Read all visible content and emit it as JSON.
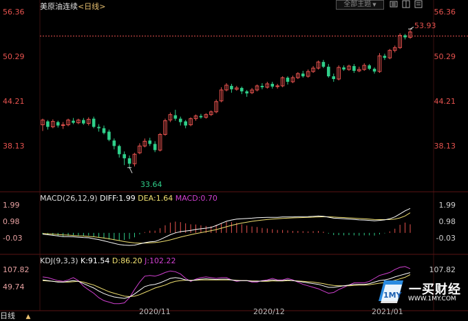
{
  "header": {
    "instrument": "美原油连续",
    "period": "<日线>",
    "theme_button": "全部主题",
    "theme_caret": "▼"
  },
  "price_axis": {
    "left_labels": [
      "56.36",
      "50.29",
      "44.21",
      "38.13"
    ],
    "right_labels": [
      "56.36",
      "50.29",
      "44.21",
      "38.13"
    ],
    "ymin": 30.5,
    "ymax": 56.36
  },
  "annotations": {
    "high_label": "53.93",
    "low_label": "33.64",
    "reference_price": 52.9
  },
  "macd": {
    "label": "MACD(26,12,9)",
    "diff_label": "DIFF:1.99",
    "dea_label": "DEA:1.64",
    "macd_label": "MACD:0.70",
    "axis_labels": [
      "1.99",
      "0.98",
      "-0.03"
    ],
    "ymin": -1.3,
    "ymax": 2.4
  },
  "kdj": {
    "label": "KDJ(9,3,3)",
    "k_label": "K:91.54",
    "d_label": "D:86.20",
    "j_label": "J:102.22",
    "axis_labels": [
      "107.82",
      "49.74"
    ],
    "ymin": 0,
    "ymax": 115
  },
  "x_axis": {
    "labels": [
      "2020/11",
      "2020/12",
      "2021/01"
    ]
  },
  "bottom": {
    "period_label": "日线",
    "caret": "▲"
  },
  "watermark": {
    "name": "一买财经",
    "url": "WWW.1MY.COM",
    "badge_text": "1MY"
  },
  "colors": {
    "up": "#e8534f",
    "down": "#2fcf8a",
    "diff_line": "#ffffff",
    "dea_line": "#f0e070",
    "j_line": "#d040d0",
    "ref_line": "#e8534f"
  },
  "chart_data": {
    "type": "candlestick",
    "title": "美原油连续",
    "candles": [
      [
        39.9,
        40.6,
        39.0,
        40.8,
        "up"
      ],
      [
        40.4,
        39.6,
        39.2,
        40.6,
        "down"
      ],
      [
        39.6,
        40.4,
        39.4,
        40.7,
        "up"
      ],
      [
        40.3,
        39.8,
        39.5,
        40.5,
        "down"
      ],
      [
        39.8,
        39.9,
        39.3,
        40.3,
        "up"
      ],
      [
        39.9,
        40.6,
        39.7,
        40.8,
        "up"
      ],
      [
        40.5,
        40.2,
        40.0,
        40.9,
        "down"
      ],
      [
        40.2,
        40.6,
        40.0,
        40.8,
        "up"
      ],
      [
        40.6,
        40.1,
        39.9,
        40.9,
        "down"
      ],
      [
        40.1,
        40.7,
        39.8,
        41.0,
        "up"
      ],
      [
        40.8,
        39.6,
        39.4,
        41.1,
        "down"
      ],
      [
        39.6,
        39.4,
        38.9,
        40.0,
        "down"
      ],
      [
        39.4,
        38.7,
        38.5,
        39.8,
        "down"
      ],
      [
        38.9,
        37.7,
        37.5,
        39.2,
        "down"
      ],
      [
        37.6,
        36.8,
        36.3,
        37.9,
        "down"
      ],
      [
        36.8,
        35.6,
        35.1,
        37.0,
        "down"
      ],
      [
        35.6,
        35.0,
        34.0,
        36.0,
        "down"
      ],
      [
        35.0,
        34.2,
        33.64,
        35.4,
        "down"
      ],
      [
        34.2,
        35.6,
        33.8,
        35.8,
        "up"
      ],
      [
        35.8,
        36.8,
        35.6,
        37.2,
        "up"
      ],
      [
        36.8,
        37.5,
        36.6,
        37.9,
        "up"
      ],
      [
        37.6,
        37.1,
        36.8,
        38.0,
        "down"
      ],
      [
        37.1,
        36.2,
        35.9,
        37.5,
        "down"
      ],
      [
        36.2,
        38.5,
        36.0,
        38.7,
        "up"
      ],
      [
        38.5,
        40.5,
        38.3,
        40.8,
        "up"
      ],
      [
        40.6,
        41.4,
        40.3,
        41.7,
        "up"
      ],
      [
        41.3,
        40.8,
        40.5,
        42.1,
        "down"
      ],
      [
        40.8,
        40.3,
        39.8,
        41.1,
        "down"
      ],
      [
        40.4,
        39.8,
        39.4,
        40.6,
        "down"
      ],
      [
        39.9,
        40.8,
        39.7,
        41.0,
        "up"
      ],
      [
        40.8,
        41.2,
        40.5,
        41.4,
        "up"
      ],
      [
        41.2,
        41.0,
        40.8,
        41.5,
        "down"
      ],
      [
        41.0,
        41.4,
        40.8,
        41.6,
        "up"
      ],
      [
        41.4,
        41.8,
        41.2,
        42.0,
        "up"
      ],
      [
        41.8,
        43.3,
        41.6,
        43.6,
        "up"
      ],
      [
        43.4,
        45.0,
        43.2,
        45.4,
        "up"
      ],
      [
        45.0,
        45.7,
        44.8,
        46.0,
        "up"
      ],
      [
        45.6,
        45.1,
        44.6,
        45.9,
        "down"
      ],
      [
        45.1,
        45.3,
        44.9,
        45.6,
        "up"
      ],
      [
        45.3,
        44.8,
        44.4,
        45.5,
        "down"
      ],
      [
        44.8,
        44.5,
        44.0,
        45.0,
        "down"
      ],
      [
        44.6,
        45.0,
        44.4,
        45.3,
        "up"
      ],
      [
        45.0,
        45.6,
        44.8,
        45.8,
        "up"
      ],
      [
        45.6,
        45.4,
        45.1,
        46.0,
        "down"
      ],
      [
        45.4,
        45.9,
        45.2,
        46.2,
        "up"
      ],
      [
        45.9,
        45.5,
        45.2,
        46.2,
        "down"
      ],
      [
        45.5,
        45.6,
        45.2,
        45.9,
        "up"
      ],
      [
        45.6,
        46.8,
        45.4,
        47.0,
        "up"
      ],
      [
        46.8,
        46.2,
        45.8,
        47.0,
        "down"
      ],
      [
        46.2,
        46.8,
        46.0,
        47.1,
        "up"
      ],
      [
        46.8,
        47.4,
        46.6,
        47.6,
        "up"
      ],
      [
        47.4,
        47.0,
        46.8,
        47.8,
        "down"
      ],
      [
        47.0,
        47.7,
        46.8,
        48.0,
        "up"
      ],
      [
        47.7,
        48.2,
        47.5,
        48.5,
        "up"
      ],
      [
        48.2,
        49.1,
        48.0,
        49.3,
        "up"
      ],
      [
        49.1,
        48.4,
        48.2,
        49.4,
        "down"
      ],
      [
        48.4,
        47.0,
        46.8,
        48.8,
        "down"
      ],
      [
        47.0,
        46.6,
        46.2,
        47.4,
        "down"
      ],
      [
        46.6,
        48.3,
        46.4,
        48.6,
        "up"
      ],
      [
        48.3,
        48.0,
        47.8,
        48.6,
        "down"
      ],
      [
        48.0,
        48.5,
        47.8,
        48.7,
        "up"
      ],
      [
        48.5,
        47.8,
        47.5,
        48.8,
        "down"
      ],
      [
        47.8,
        48.0,
        47.6,
        48.4,
        "up"
      ],
      [
        48.0,
        48.6,
        47.8,
        48.9,
        "up"
      ],
      [
        48.6,
        48.1,
        47.9,
        48.8,
        "down"
      ],
      [
        48.1,
        47.7,
        47.4,
        48.3,
        "down"
      ],
      [
        47.7,
        50.0,
        47.5,
        50.4,
        "up"
      ],
      [
        50.0,
        49.7,
        49.4,
        50.3,
        "down"
      ],
      [
        49.7,
        50.8,
        49.5,
        51.0,
        "up"
      ],
      [
        50.8,
        51.2,
        50.5,
        51.5,
        "up"
      ],
      [
        51.2,
        53.0,
        51.0,
        53.3,
        "up"
      ],
      [
        53.0,
        52.7,
        52.4,
        53.2,
        "down"
      ],
      [
        52.7,
        53.5,
        52.5,
        53.9,
        "up"
      ]
    ],
    "diff": [
      -0.1,
      -0.15,
      -0.2,
      -0.25,
      -0.3,
      -0.3,
      -0.32,
      -0.35,
      -0.38,
      -0.4,
      -0.48,
      -0.55,
      -0.65,
      -0.75,
      -0.85,
      -0.95,
      -1.0,
      -1.02,
      -1.0,
      -0.9,
      -0.8,
      -0.72,
      -0.7,
      -0.55,
      -0.35,
      -0.15,
      0.0,
      0.1,
      0.15,
      0.2,
      0.28,
      0.33,
      0.38,
      0.45,
      0.6,
      0.78,
      0.95,
      1.05,
      1.12,
      1.15,
      1.17,
      1.2,
      1.24,
      1.25,
      1.27,
      1.27,
      1.27,
      1.3,
      1.3,
      1.3,
      1.32,
      1.32,
      1.33,
      1.35,
      1.38,
      1.36,
      1.28,
      1.2,
      1.18,
      1.15,
      1.13,
      1.1,
      1.06,
      1.05,
      1.02,
      0.98,
      1.02,
      1.06,
      1.15,
      1.3,
      1.55,
      1.8,
      1.99
    ],
    "dea": [
      -0.05,
      -0.07,
      -0.1,
      -0.13,
      -0.16,
      -0.18,
      -0.21,
      -0.24,
      -0.26,
      -0.29,
      -0.32,
      -0.37,
      -0.42,
      -0.48,
      -0.56,
      -0.63,
      -0.71,
      -0.77,
      -0.82,
      -0.84,
      -0.83,
      -0.81,
      -0.79,
      -0.74,
      -0.66,
      -0.57,
      -0.46,
      -0.34,
      -0.24,
      -0.15,
      -0.06,
      0.02,
      0.1,
      0.18,
      0.27,
      0.38,
      0.5,
      0.61,
      0.71,
      0.8,
      0.87,
      0.94,
      1.0,
      1.05,
      1.09,
      1.12,
      1.15,
      1.18,
      1.2,
      1.22,
      1.24,
      1.25,
      1.27,
      1.28,
      1.3,
      1.31,
      1.31,
      1.29,
      1.27,
      1.25,
      1.22,
      1.2,
      1.17,
      1.15,
      1.12,
      1.09,
      1.08,
      1.08,
      1.09,
      1.13,
      1.22,
      1.38,
      1.64
    ],
    "k": [
      72,
      70,
      68,
      66,
      66,
      68,
      70,
      68,
      62,
      56,
      50,
      42,
      35,
      30,
      26,
      24,
      22,
      26,
      34,
      44,
      54,
      58,
      60,
      64,
      70,
      76,
      78,
      76,
      72,
      70,
      72,
      74,
      75,
      74,
      73,
      74,
      74,
      72,
      70,
      70,
      70,
      68,
      68,
      69,
      70,
      72,
      70,
      70,
      72,
      70,
      68,
      66,
      64,
      62,
      60,
      56,
      52,
      52,
      54,
      56,
      58,
      60,
      60,
      60,
      62,
      66,
      70,
      72,
      75,
      80,
      84,
      88,
      91.54
    ],
    "d": [
      70,
      69,
      68,
      67,
      66,
      66,
      67,
      68,
      66,
      62,
      58,
      52,
      46,
      40,
      36,
      32,
      28,
      27,
      28,
      32,
      38,
      44,
      50,
      54,
      58,
      64,
      68,
      70,
      71,
      71,
      71,
      72,
      72,
      72,
      72,
      72,
      72,
      72,
      71,
      70,
      70,
      69,
      69,
      68,
      68,
      69,
      69,
      69,
      70,
      70,
      69,
      68,
      67,
      66,
      64,
      62,
      59,
      57,
      56,
      56,
      56,
      57,
      58,
      58,
      59,
      61,
      63,
      65,
      68,
      71,
      75,
      79,
      86.2
    ],
    "j": [
      80,
      78,
      74,
      70,
      68,
      72,
      78,
      70,
      55,
      45,
      36,
      24,
      16,
      12,
      8,
      8,
      10,
      24,
      46,
      66,
      82,
      84,
      82,
      86,
      92,
      96,
      94,
      88,
      76,
      68,
      74,
      78,
      80,
      78,
      76,
      78,
      78,
      72,
      68,
      70,
      70,
      66,
      66,
      70,
      72,
      76,
      72,
      72,
      76,
      72,
      66,
      60,
      56,
      52,
      48,
      42,
      36,
      38,
      46,
      52,
      58,
      64,
      64,
      64,
      68,
      76,
      84,
      88,
      92,
      100,
      106,
      108,
      102.22
    ]
  }
}
